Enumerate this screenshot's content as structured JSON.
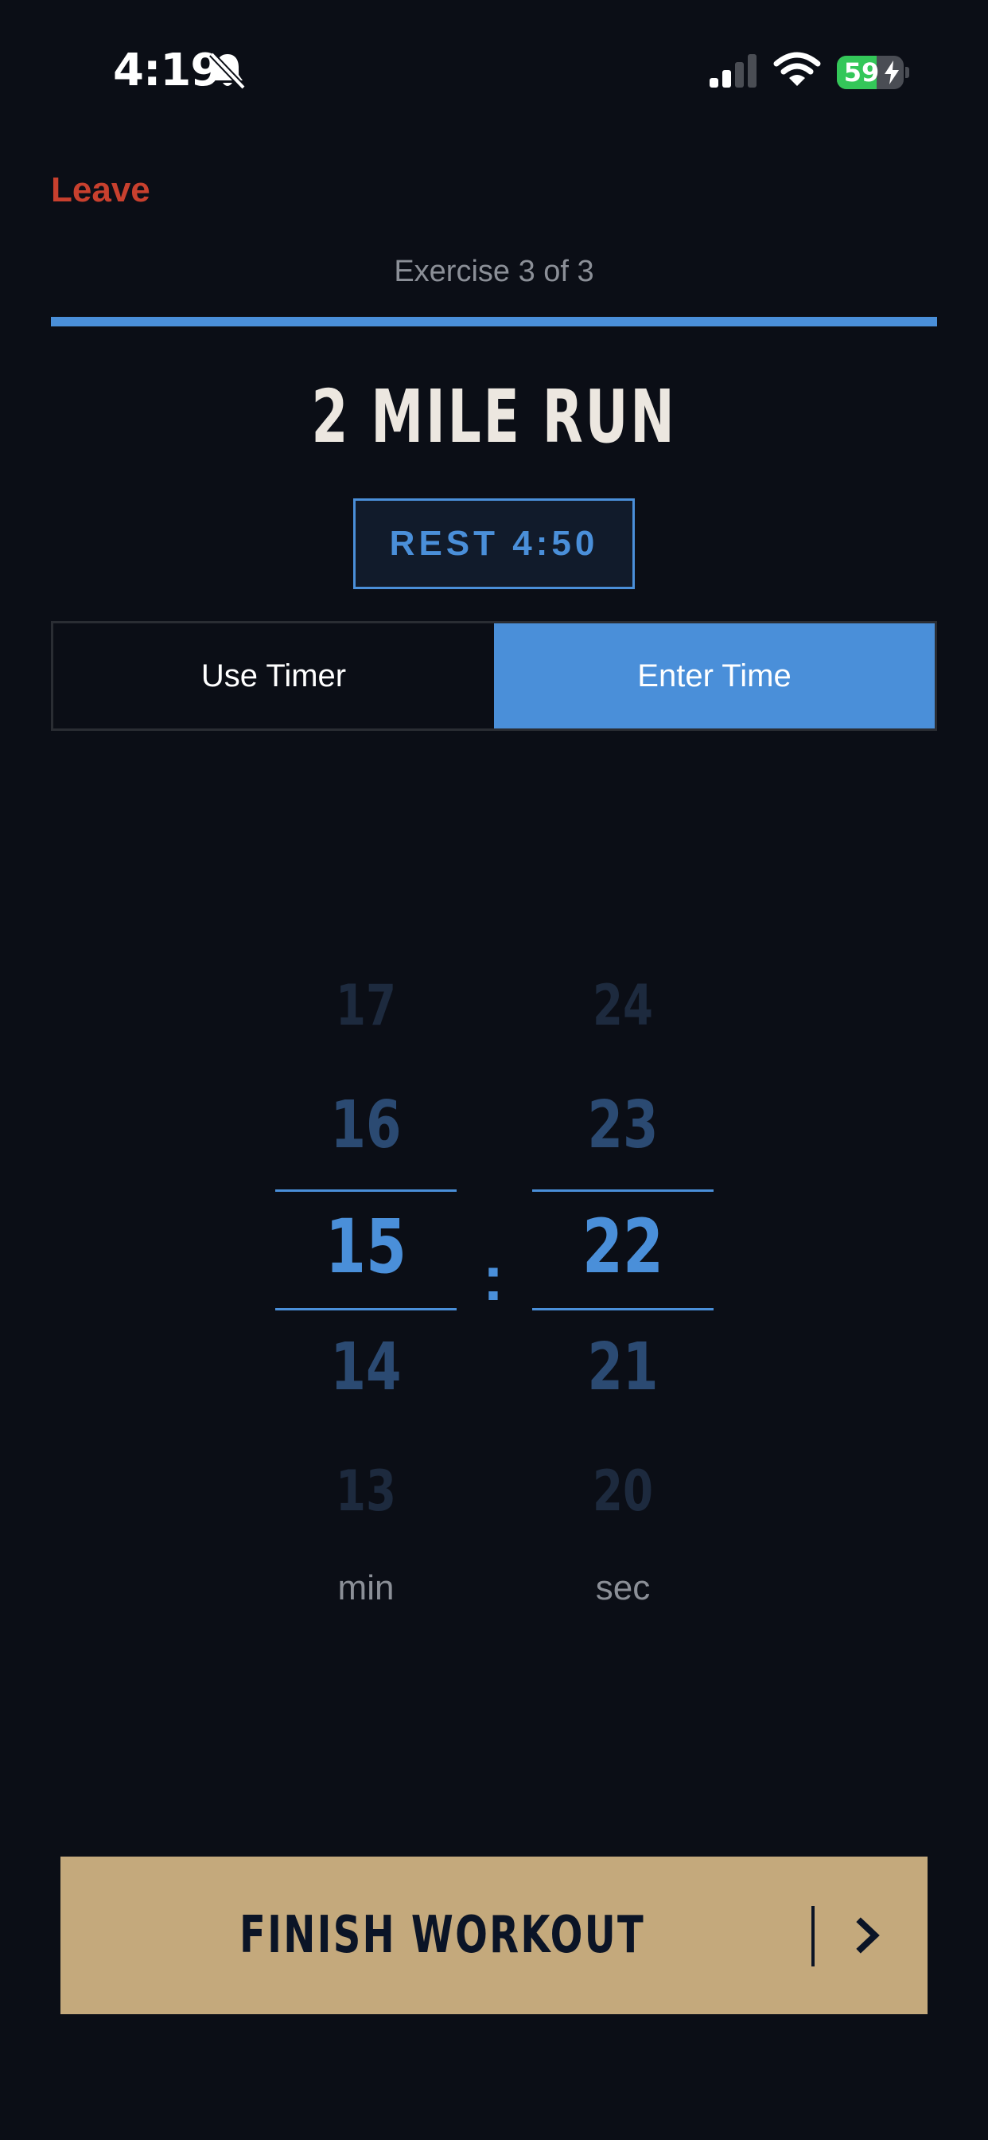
{
  "status_bar": {
    "time": "4:19",
    "battery_level": "59",
    "icons": [
      "bell-slash-icon",
      "signal-icon",
      "wifi-icon",
      "battery-icon",
      "bolt-icon"
    ]
  },
  "header": {
    "leave_label": "Leave",
    "progress_label": "Exercise 3 of 3",
    "progress_fraction": 1.0
  },
  "exercise": {
    "title": "2 MILE RUN",
    "rest_label": "REST 4:50"
  },
  "mode_toggle": {
    "options": [
      "Use Timer",
      "Enter Time"
    ],
    "selected": "Enter Time"
  },
  "picker": {
    "minutes": {
      "values": [
        "17",
        "16",
        "15",
        "14",
        "13"
      ],
      "selected": "15",
      "unit": "min"
    },
    "separator": ":",
    "seconds": {
      "values": [
        "24",
        "23",
        "22",
        "21",
        "20"
      ],
      "selected": "22",
      "unit": "sec"
    }
  },
  "footer": {
    "finish_label": "FINISH WORKOUT"
  },
  "colors": {
    "background": "#0b0e16",
    "accent_blue": "#4a8fd9",
    "leave_red": "#c8402e",
    "gold": "#c4a97c",
    "battery_green": "#34c759"
  }
}
